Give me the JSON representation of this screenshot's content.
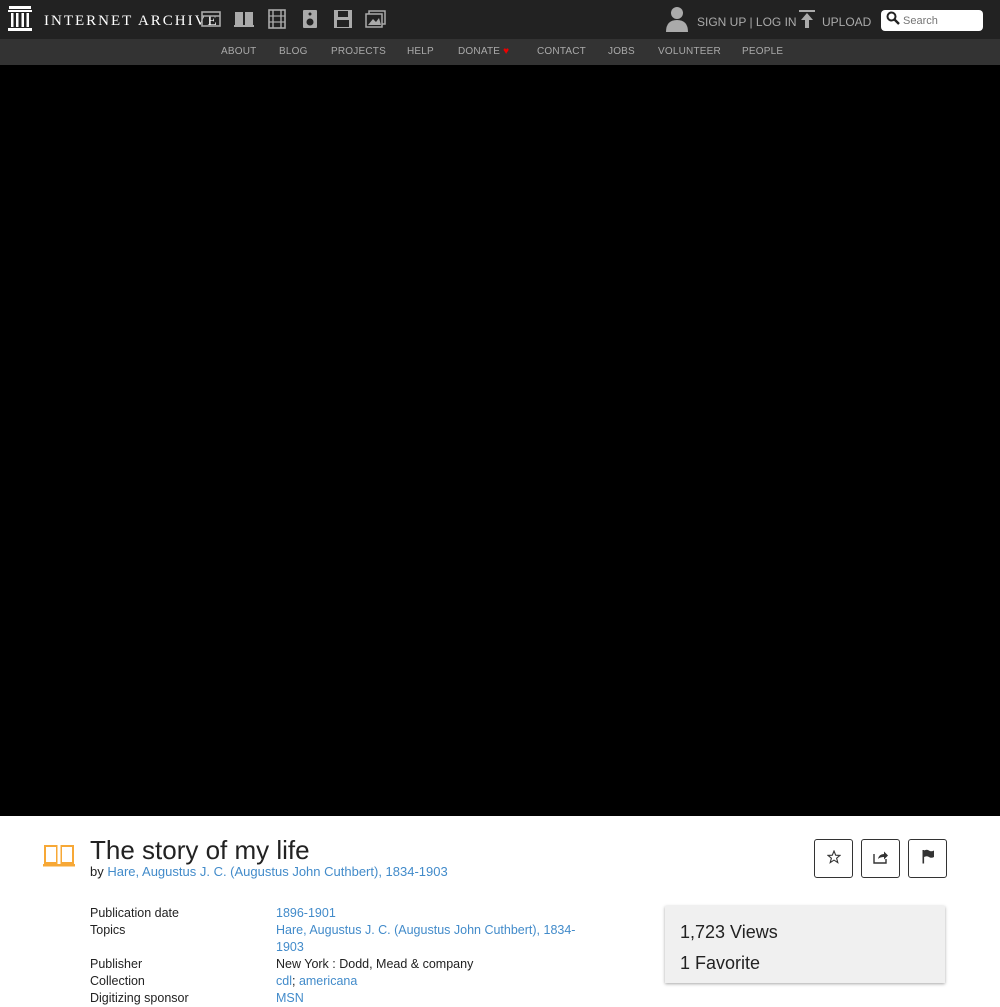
{
  "header": {
    "logo_text": "INTERNET ARCHIVE",
    "media_icons": [
      "web-icon",
      "texts-icon",
      "video-icon",
      "audio-icon",
      "software-icon",
      "images-icon"
    ],
    "auth_text": "SIGN UP | LOG IN",
    "upload_label": "UPLOAD",
    "search_placeholder": "Search"
  },
  "nav": {
    "items": [
      "ABOUT",
      "BLOG",
      "PROJECTS",
      "HELP",
      "DONATE",
      "CONTACT",
      "JOBS",
      "VOLUNTEER",
      "PEOPLE"
    ]
  },
  "item": {
    "title": "The story of my life",
    "by_prefix": "by ",
    "author": "Hare, Augustus J. C. (Augustus John Cuthbert), 1834-1903",
    "metadata": [
      {
        "key": "Publication date",
        "value": "1896-1901"
      },
      {
        "key": "Topics",
        "value": "Hare, Augustus J. C. (Augustus John Cuthbert), 1834-1903"
      },
      {
        "key": "Publisher",
        "value": "New York : Dodd, Mead & company"
      },
      {
        "key": "Collection",
        "value_parts": [
          "cdl",
          "; ",
          "americana"
        ]
      },
      {
        "key": "Digitizing sponsor",
        "value": "MSN"
      }
    ]
  },
  "stats": {
    "views": "1,723 Views",
    "favorites": "1 Favorite"
  },
  "colors": {
    "topbar": "#222222",
    "navbar": "#333333",
    "link": "#428bca",
    "book_icon": "#f7a836",
    "donate_heart": "#ff0000"
  }
}
